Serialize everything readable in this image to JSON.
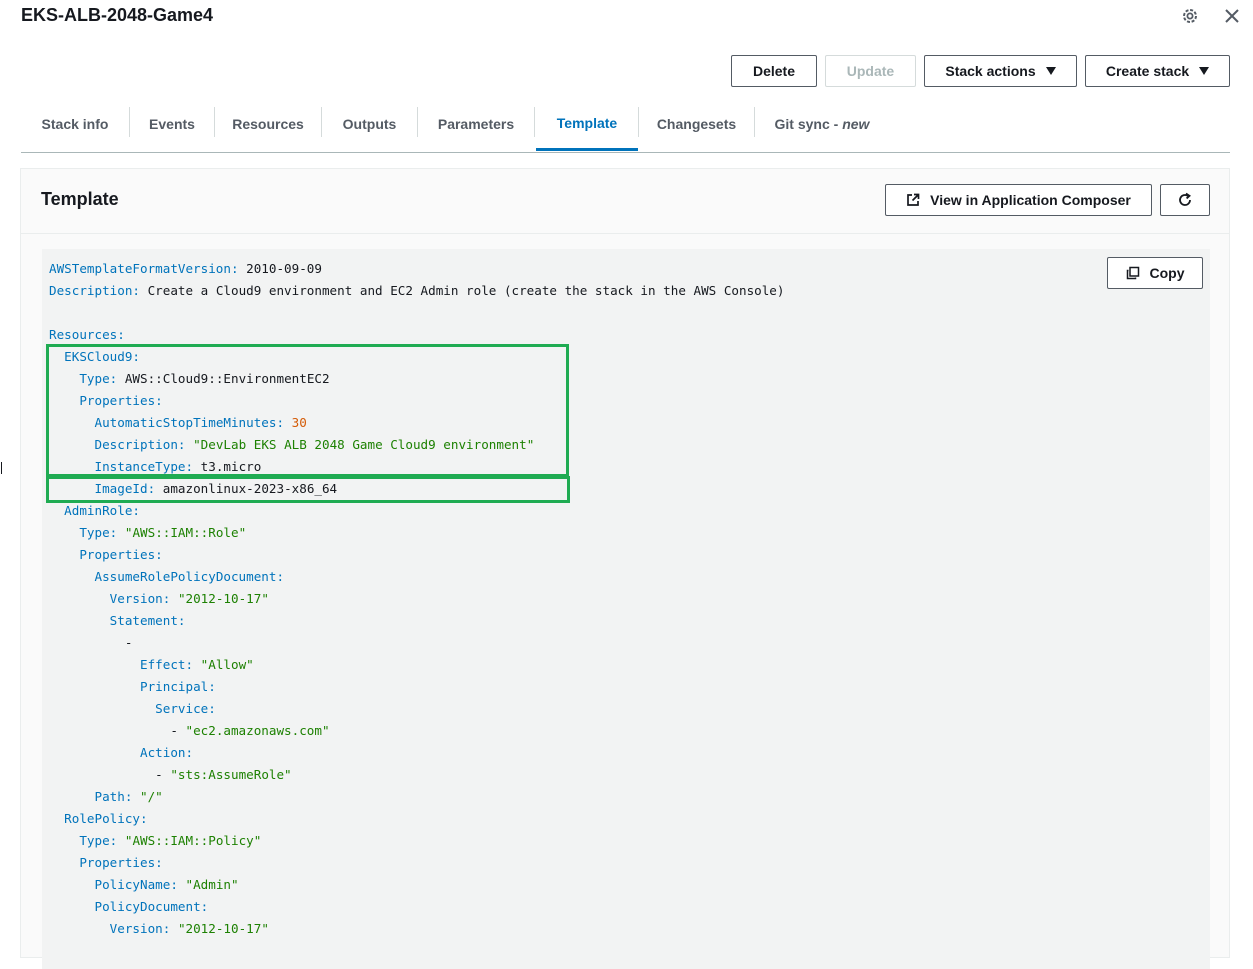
{
  "header": {
    "title": "EKS-ALB-2048-Game4",
    "icons": {
      "settings": "gear-icon",
      "close": "close-icon"
    }
  },
  "actions": {
    "delete": "Delete",
    "update": "Update",
    "stack_actions": "Stack actions",
    "create_stack": "Create stack"
  },
  "tabs": [
    {
      "label": "Stack info"
    },
    {
      "label": "Events"
    },
    {
      "label": "Resources"
    },
    {
      "label": "Outputs"
    },
    {
      "label": "Parameters"
    },
    {
      "label": "Template"
    },
    {
      "label": "Changesets"
    },
    {
      "label": "Git sync - ",
      "badge": "new"
    }
  ],
  "active_tab": "Template",
  "panel": {
    "title": "Template",
    "view_composer": "View in Application Composer",
    "copy": "Copy"
  },
  "template_lines": [
    [
      {
        "t": "k",
        "v": "AWSTemplateFormatVersion:"
      },
      {
        "t": "v",
        "v": " 2010-09-09"
      }
    ],
    [
      {
        "t": "k",
        "v": "Description:"
      },
      {
        "t": "v",
        "v": " Create a Cloud9 environment and EC2 Admin role (create the stack in the AWS Console)"
      }
    ],
    [],
    [
      {
        "t": "k",
        "v": "Resources:"
      }
    ],
    [
      {
        "t": "v",
        "v": "  "
      },
      {
        "t": "k",
        "v": "EKSCloud9:"
      }
    ],
    [
      {
        "t": "v",
        "v": "    "
      },
      {
        "t": "k",
        "v": "Type:"
      },
      {
        "t": "v",
        "v": " AWS::Cloud9::EnvironmentEC2"
      }
    ],
    [
      {
        "t": "v",
        "v": "    "
      },
      {
        "t": "k",
        "v": "Properties:"
      }
    ],
    [
      {
        "t": "v",
        "v": "      "
      },
      {
        "t": "k",
        "v": "AutomaticStopTimeMinutes:"
      },
      {
        "t": "v",
        "v": " "
      },
      {
        "t": "n",
        "v": "30"
      }
    ],
    [
      {
        "t": "v",
        "v": "      "
      },
      {
        "t": "k",
        "v": "Description:"
      },
      {
        "t": "v",
        "v": " "
      },
      {
        "t": "s",
        "v": "\"DevLab EKS ALB 2048 Game Cloud9 environment\""
      }
    ],
    [
      {
        "t": "v",
        "v": "      "
      },
      {
        "t": "k",
        "v": "InstanceType:"
      },
      {
        "t": "v",
        "v": " t3.micro"
      }
    ],
    [
      {
        "t": "v",
        "v": "      "
      },
      {
        "t": "k",
        "v": "ImageId:"
      },
      {
        "t": "v",
        "v": " amazonlinux-2023-x86_64"
      }
    ],
    [
      {
        "t": "v",
        "v": "  "
      },
      {
        "t": "k",
        "v": "AdminRole:"
      }
    ],
    [
      {
        "t": "v",
        "v": "    "
      },
      {
        "t": "k",
        "v": "Type:"
      },
      {
        "t": "v",
        "v": " "
      },
      {
        "t": "s",
        "v": "\"AWS::IAM::Role\""
      }
    ],
    [
      {
        "t": "v",
        "v": "    "
      },
      {
        "t": "k",
        "v": "Properties:"
      }
    ],
    [
      {
        "t": "v",
        "v": "      "
      },
      {
        "t": "k",
        "v": "AssumeRolePolicyDocument:"
      }
    ],
    [
      {
        "t": "v",
        "v": "        "
      },
      {
        "t": "k",
        "v": "Version:"
      },
      {
        "t": "v",
        "v": " "
      },
      {
        "t": "s",
        "v": "\"2012-10-17\""
      }
    ],
    [
      {
        "t": "v",
        "v": "        "
      },
      {
        "t": "k",
        "v": "Statement:"
      }
    ],
    [
      {
        "t": "v",
        "v": "          -"
      }
    ],
    [
      {
        "t": "v",
        "v": "            "
      },
      {
        "t": "k",
        "v": "Effect:"
      },
      {
        "t": "v",
        "v": " "
      },
      {
        "t": "s",
        "v": "\"Allow\""
      }
    ],
    [
      {
        "t": "v",
        "v": "            "
      },
      {
        "t": "k",
        "v": "Principal:"
      }
    ],
    [
      {
        "t": "v",
        "v": "              "
      },
      {
        "t": "k",
        "v": "Service:"
      }
    ],
    [
      {
        "t": "v",
        "v": "                - "
      },
      {
        "t": "s",
        "v": "\"ec2.amazonaws.com\""
      }
    ],
    [
      {
        "t": "v",
        "v": "            "
      },
      {
        "t": "k",
        "v": "Action:"
      }
    ],
    [
      {
        "t": "v",
        "v": "              - "
      },
      {
        "t": "s",
        "v": "\"sts:AssumeRole\""
      }
    ],
    [
      {
        "t": "v",
        "v": "      "
      },
      {
        "t": "k",
        "v": "Path:"
      },
      {
        "t": "v",
        "v": " "
      },
      {
        "t": "s",
        "v": "\"/\""
      }
    ],
    [
      {
        "t": "v",
        "v": "  "
      },
      {
        "t": "k",
        "v": "RolePolicy:"
      }
    ],
    [
      {
        "t": "v",
        "v": "    "
      },
      {
        "t": "k",
        "v": "Type:"
      },
      {
        "t": "v",
        "v": " "
      },
      {
        "t": "s",
        "v": "\"AWS::IAM::Policy\""
      }
    ],
    [
      {
        "t": "v",
        "v": "    "
      },
      {
        "t": "k",
        "v": "Properties:"
      }
    ],
    [
      {
        "t": "v",
        "v": "      "
      },
      {
        "t": "k",
        "v": "PolicyName:"
      },
      {
        "t": "v",
        "v": " "
      },
      {
        "t": "s",
        "v": "\"Admin\""
      }
    ],
    [
      {
        "t": "v",
        "v": "      "
      },
      {
        "t": "k",
        "v": "PolicyDocument:"
      }
    ],
    [
      {
        "t": "v",
        "v": "        "
      },
      {
        "t": "k",
        "v": "Version:"
      },
      {
        "t": "v",
        "v": " "
      },
      {
        "t": "s",
        "v": "\"2012-10-17\""
      }
    ]
  ],
  "colors": {
    "key": "#0073bb",
    "string": "#1d8102",
    "number": "#d45b07",
    "highlight_box": "#1fab52",
    "active_tab": "#0073bb"
  }
}
